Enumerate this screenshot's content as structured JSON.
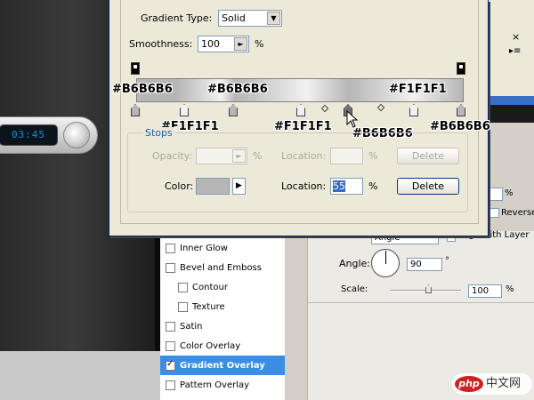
{
  "background_widget": {
    "lcd_text": "03:45"
  },
  "dialog": {
    "gradient_type_label": "Gradient Type:",
    "gradient_type_value": "Solid",
    "smoothness_label": "Smoothness:",
    "smoothness_value": "100",
    "smoothness_unit": "%",
    "hex_labels": {
      "top_left": "#B6B6B6",
      "top_mid": "#B6B6B6",
      "top_right": "#F1F1F1",
      "bottom_1": "#F1F1F1",
      "bottom_2": "#F1F1F1",
      "bottom_3": "#B6B6B6",
      "bottom_4": "#B6B6B6"
    },
    "stops_legend": "Stops",
    "opacity_label": "Opacity:",
    "opacity_unit": "%",
    "opacity_location_label": "Location:",
    "opacity_location_unit": "%",
    "opacity_delete_label": "Delete",
    "color_label": "Color:",
    "color_swatch_hex": "#B6B6B6",
    "color_location_label": "Location:",
    "color_location_value": "55",
    "color_location_unit": "%",
    "color_delete_label": "Delete"
  },
  "styles_list": [
    {
      "label": "Inner Glow",
      "checked": false
    },
    {
      "label": "Bevel and Emboss",
      "checked": false
    },
    {
      "label": "Contour",
      "checked": false
    },
    {
      "label": "Texture",
      "checked": false
    },
    {
      "label": "Satin",
      "checked": false
    },
    {
      "label": "Color Overlay",
      "checked": false
    },
    {
      "label": "Gradient Overlay",
      "checked": true
    },
    {
      "label": "Pattern Overlay",
      "checked": false
    }
  ],
  "right_panel": {
    "percent_sign": "%",
    "reverse_label": "Reverse",
    "style_value": "Angle",
    "align_label": "Align with Layer",
    "angle_label": "Angle:",
    "angle_value": "90",
    "angle_unit": "°",
    "scale_label": "Scale:",
    "scale_value": "100",
    "scale_unit": "%"
  },
  "window_controls": {
    "close_glyph": "×",
    "menu_glyph": "▸≡"
  },
  "watermark": {
    "logo": "php",
    "text": "中文网"
  },
  "colors": {
    "accent": "#3a8ee6",
    "stop_dark": "#B6B6B6",
    "stop_light": "#F1F1F1"
  }
}
